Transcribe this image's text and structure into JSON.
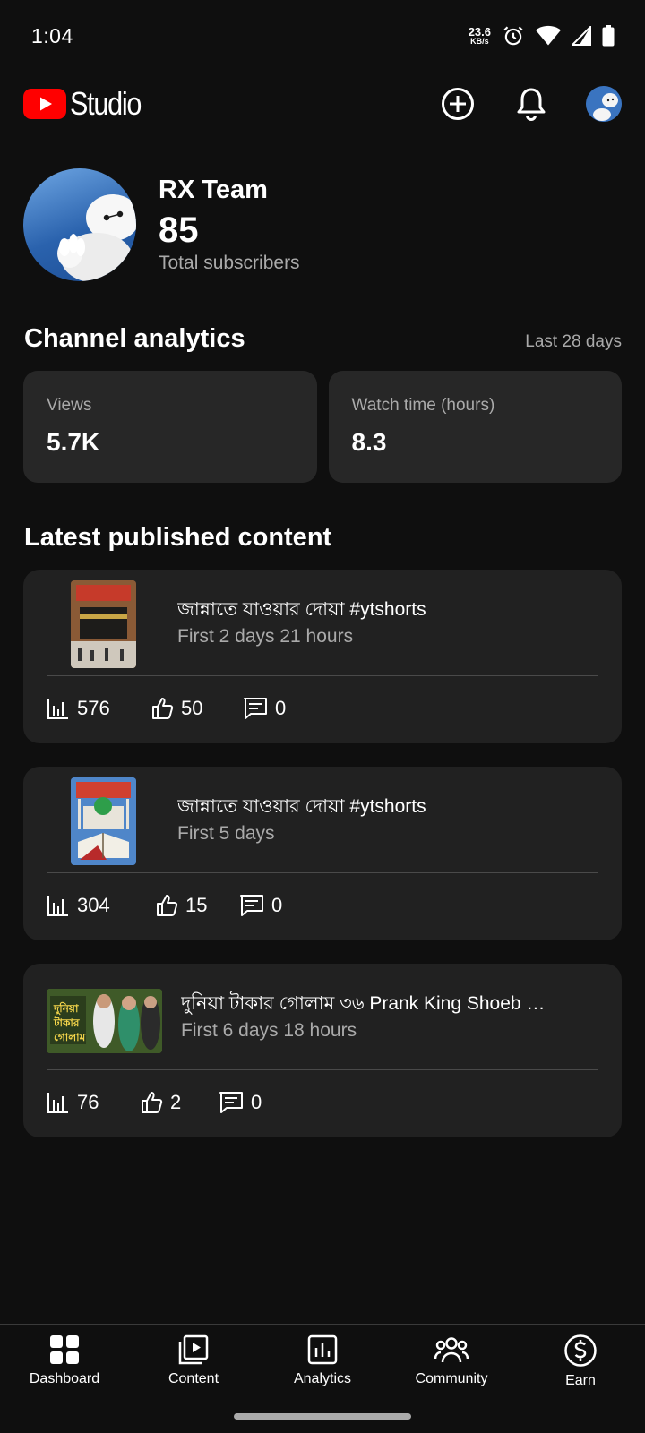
{
  "status_bar": {
    "time": "1:04",
    "net_speed_value": "23.6",
    "net_speed_unit": "KB/s"
  },
  "header": {
    "app_name": "Studio",
    "brand_color": "#ff0000"
  },
  "channel": {
    "name": "RX Team",
    "subscriber_count": "85",
    "subscriber_label": "Total subscribers"
  },
  "analytics": {
    "title": "Channel analytics",
    "range": "Last 28 days",
    "cards": [
      {
        "label": "Views",
        "value": "5.7K"
      },
      {
        "label": "Watch time (hours)",
        "value": "8.3"
      }
    ]
  },
  "latest": {
    "title": "Latest published content",
    "items": [
      {
        "title": "জান্নাতে যাওয়ার দোয়া #ytshorts",
        "subtitle": "First 2 days 21 hours",
        "views": "576",
        "likes": "50",
        "comments": "0"
      },
      {
        "title": "জান্নাতে যাওয়ার দোয়া #ytshorts",
        "subtitle": "First 5 days",
        "views": "304",
        "likes": "15",
        "comments": "0"
      },
      {
        "title": "দুনিয়া টাকার গোলাম ৩৬  Prank King   Shoeb …",
        "subtitle": "First 6 days 18 hours",
        "views": "76",
        "likes": "2",
        "comments": "0"
      }
    ]
  },
  "nav": {
    "items": [
      {
        "label": "Dashboard",
        "icon": "dashboard-icon"
      },
      {
        "label": "Content",
        "icon": "content-icon"
      },
      {
        "label": "Analytics",
        "icon": "analytics-icon"
      },
      {
        "label": "Community",
        "icon": "community-icon"
      },
      {
        "label": "Earn",
        "icon": "earn-icon"
      }
    ]
  }
}
